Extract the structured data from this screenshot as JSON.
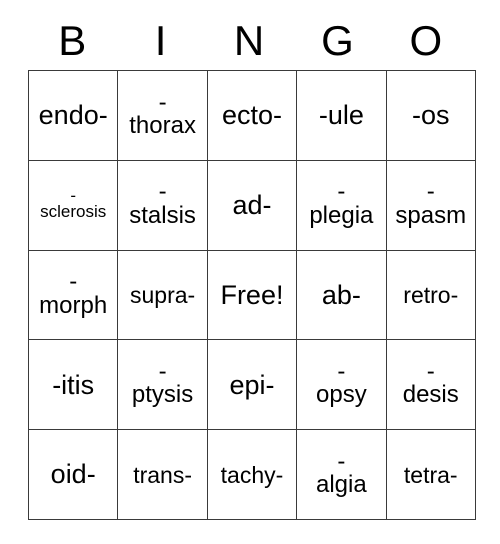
{
  "card": {
    "title": "BINGO",
    "free_space_label": "Free!",
    "header_letters": [
      "B",
      "I",
      "N",
      "G",
      "O"
    ],
    "colors": {
      "background": "#ffffff",
      "text": "#000000",
      "grid_border": "#3a3a3a"
    },
    "rows": [
      [
        {
          "text": "endo-",
          "lines": [
            "endo-"
          ],
          "size": "normal"
        },
        {
          "text": "-thorax",
          "lines": [
            "-",
            "thorax"
          ],
          "size": "normal"
        },
        {
          "text": "ecto-",
          "lines": [
            "ecto-"
          ],
          "size": "normal"
        },
        {
          "text": "-ule",
          "lines": [
            "-ule"
          ],
          "size": "normal"
        },
        {
          "text": "-os",
          "lines": [
            "-os"
          ],
          "size": "normal"
        }
      ],
      [
        {
          "text": "-sclerosis",
          "lines": [
            "-",
            "sclerosis"
          ],
          "size": "small"
        },
        {
          "text": "-stalsis",
          "lines": [
            "-",
            "stalsis"
          ],
          "size": "normal"
        },
        {
          "text": "ad-",
          "lines": [
            "ad-"
          ],
          "size": "normal"
        },
        {
          "text": "-plegia",
          "lines": [
            "-",
            "plegia"
          ],
          "size": "normal"
        },
        {
          "text": "-spasm",
          "lines": [
            "-",
            "spasm"
          ],
          "size": "normal"
        }
      ],
      [
        {
          "text": "-morph",
          "lines": [
            "-",
            "morph"
          ],
          "size": "normal"
        },
        {
          "text": "supra-",
          "lines": [
            "supra-"
          ],
          "size": "small"
        },
        {
          "text": "Free!",
          "lines": [
            "Free!"
          ],
          "size": "normal"
        },
        {
          "text": "ab-",
          "lines": [
            "ab-"
          ],
          "size": "normal"
        },
        {
          "text": "retro-",
          "lines": [
            "retro-"
          ],
          "size": "small"
        }
      ],
      [
        {
          "text": "-itis",
          "lines": [
            "-itis"
          ],
          "size": "normal"
        },
        {
          "text": "-ptysis",
          "lines": [
            "-",
            "ptysis"
          ],
          "size": "normal"
        },
        {
          "text": "epi-",
          "lines": [
            "epi-"
          ],
          "size": "normal"
        },
        {
          "text": "-opsy",
          "lines": [
            "-",
            "opsy"
          ],
          "size": "normal"
        },
        {
          "text": "-desis",
          "lines": [
            "-",
            "desis"
          ],
          "size": "normal"
        }
      ],
      [
        {
          "text": "oid-",
          "lines": [
            "oid-"
          ],
          "size": "normal"
        },
        {
          "text": "trans-",
          "lines": [
            "trans-"
          ],
          "size": "small"
        },
        {
          "text": "tachy-",
          "lines": [
            "tachy-"
          ],
          "size": "small"
        },
        {
          "text": "-algia",
          "lines": [
            "-",
            "algia"
          ],
          "size": "normal"
        },
        {
          "text": "tetra-",
          "lines": [
            "tetra-"
          ],
          "size": "small"
        }
      ]
    ]
  }
}
